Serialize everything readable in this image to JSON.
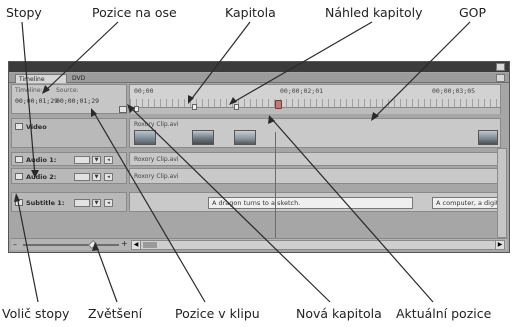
{
  "annotations": {
    "top": {
      "stopy": "Stopy",
      "pozice_na_ose": "Pozice na ose",
      "kapitola": "Kapitola",
      "nahled_kapitoly": "Náhled kapitoly",
      "gop": "GOP"
    },
    "bottom": {
      "volic_stopy": "Volič stopy",
      "zvetseni": "Zvětšení",
      "pozice_v_klipu": "Pozice v klipu",
      "nova_kapitola": "Nová kapitola",
      "aktualni_pozice": "Aktuální pozice"
    }
  },
  "window": {
    "tabs": [
      "Timeline",
      "DVD"
    ]
  },
  "timecode": {
    "timeline_label": "Timeline:",
    "source_label": "Source:",
    "timeline_value": "00;00;01;29",
    "source_value": "00;00;01;29"
  },
  "ruler": {
    "start": "00;00",
    "mid": "00;00;02;01",
    "end": "00;00;03;05"
  },
  "tracks": {
    "video": {
      "name": "Video",
      "clip_label": "Roxory Clip.avi"
    },
    "audio1": {
      "name": "Audio 1:",
      "clip_label": "Roxory Clip.avi"
    },
    "audio2": {
      "name": "Audio 2:",
      "clip_label": "Roxory Clip.avi"
    },
    "subtitle1": {
      "name": "Subtitle 1:",
      "subtitles": [
        "A dragon turns to a sketch.",
        "A computer, a digital..."
      ]
    }
  },
  "colors": {
    "panel_bg": "#a6a6a6",
    "titlebar": "#3b3b3b",
    "leader_line": "#2a2a2a"
  },
  "icons": [
    "close-icon",
    "track-expand-icon",
    "speaker-icon",
    "dropdown-icon",
    "zoom-slider-thumb",
    "scroll-left-icon",
    "scroll-right-icon"
  ]
}
